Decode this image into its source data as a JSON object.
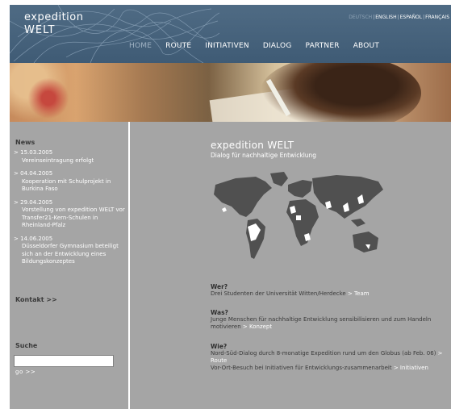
{
  "header": {
    "logo_line1": "expedition",
    "logo_line2": "WELT",
    "languages": [
      {
        "label": "DEUTSCH",
        "active": true
      },
      {
        "label": "ENGLISH",
        "active": false
      },
      {
        "label": "ESPAÑOL",
        "active": false
      },
      {
        "label": "FRANÇAIS",
        "active": false
      }
    ],
    "nav": [
      {
        "label": "HOME",
        "active": true
      },
      {
        "label": "ROUTE",
        "active": false
      },
      {
        "label": "INITIATIVEN",
        "active": false
      },
      {
        "label": "DIALOG",
        "active": false
      },
      {
        "label": "PARTNER",
        "active": false
      },
      {
        "label": "ABOUT",
        "active": false
      }
    ]
  },
  "sidebar": {
    "news_heading": "News",
    "news": [
      {
        "date": "15.03.2005",
        "text": "Vereinseintragung erfolgt"
      },
      {
        "date": "04.04.2005",
        "text": "Kooperation mit Schulprojekt in Burkina Faso"
      },
      {
        "date": "29.04.2005",
        "text": "Vorstellung von expedition WELT vor Transfer21-Kern-Schulen in Rheinland-Pfalz"
      },
      {
        "date": "14.06.2005",
        "text": "Düsseldorfer Gymnasium beteiligt sich an der Entwicklung eines Bildungskonzeptes"
      }
    ],
    "arrow": ">",
    "kontakt": "Kontakt >>",
    "search_heading": "Suche",
    "search_value": "",
    "go_label": "go >>"
  },
  "main": {
    "title": "expedition WELT",
    "subtitle": "Dialog für nachhaltige Entwicklung",
    "sections": [
      {
        "question": "Wer?",
        "answer": "Drei Studenten der Universität Witten/Herdecke",
        "link": "> Team"
      },
      {
        "question": "Was?",
        "answer": "Junge Menschen für nachhaltige Entwicklung sensibilisieren und zum Handeln motivieren",
        "link": "> Konzept"
      },
      {
        "question": "Wie?",
        "answer": "Nord-Süd-Dialog durch 8-monatige Expedition rund um den Globus (ab Feb. 06) ",
        "link": "> Route",
        "answer2": "Vor-Ort-Besuch bei Initiativen für Entwicklungs-zusammenarbeit ",
        "link2": "> Initiativen"
      }
    ]
  },
  "colors": {
    "header_bg": "#46627c",
    "content_bg": "#a5a5a5",
    "continent_dark": "#505050",
    "continent_light": "#ffffff"
  }
}
